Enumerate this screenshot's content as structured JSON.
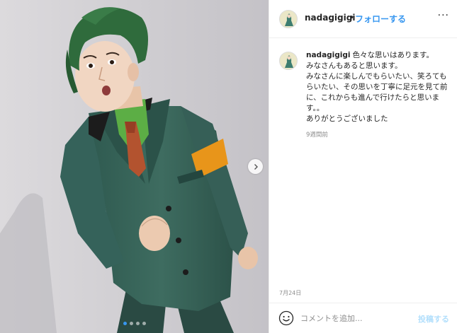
{
  "post": {
    "username": "nadagigigi",
    "separator": "•",
    "follow_label": "フォローする",
    "more_label": "···",
    "caption_username": "nadagigigi",
    "caption_text": "色々な思いはあります。\nみなさんもあると思います。\nみなさんに楽しんでもらいたい、笑ろてもらいたい、その思いを丁寧に足元を見て前に、これからも進んで行けたらと思います。。\nありがとうございました",
    "time_ago": "9週間前",
    "date": "7月24日",
    "comment_placeholder": "コメントを追加...",
    "post_label": "投稿する"
  },
  "carousel": {
    "slide_count": 4,
    "active_index": 0
  },
  "icons": {
    "next": "chevron-right-icon",
    "emoji": "smiley-icon",
    "avatar": "avatar-figure"
  },
  "colors": {
    "link_blue": "#3897f0",
    "post_disabled": "#b2dffc",
    "muted": "#8e8e8e",
    "text": "#262626"
  }
}
